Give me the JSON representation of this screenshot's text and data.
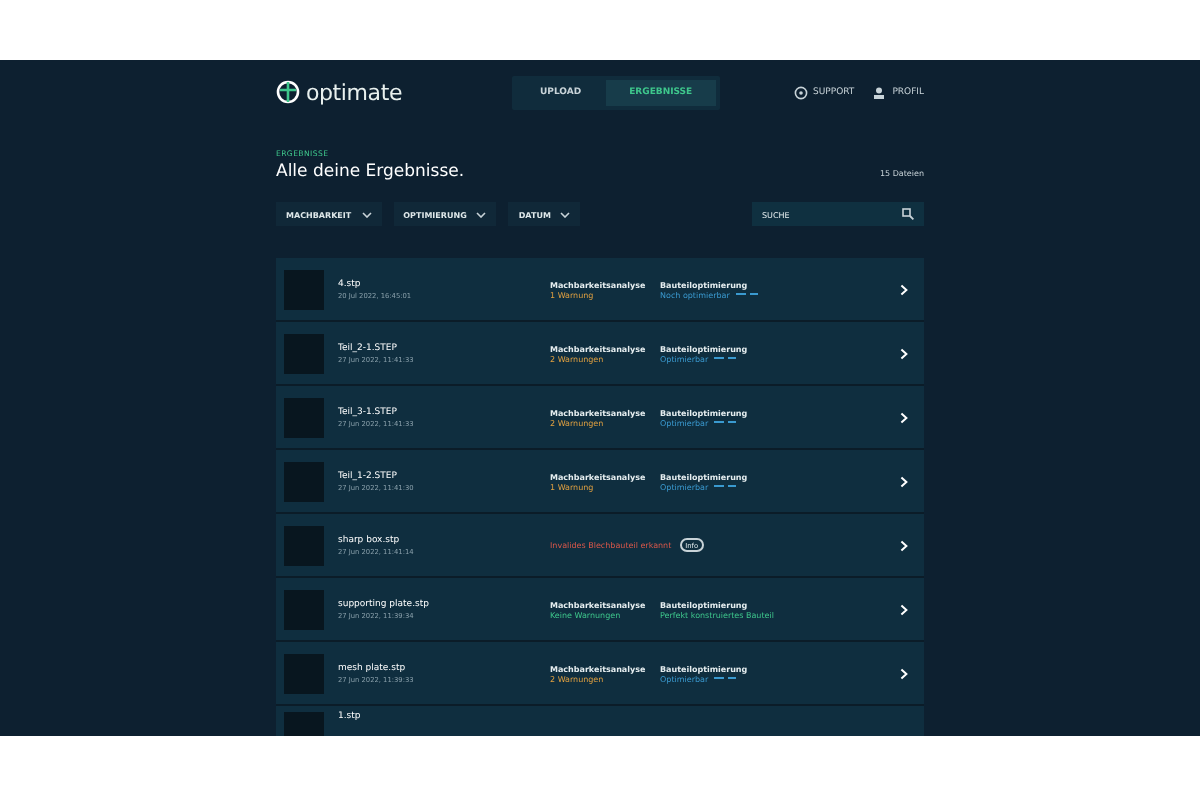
{
  "header": {
    "logo": "optimate",
    "nav": [
      {
        "label": "UPLOAD",
        "selected": false
      },
      {
        "label": "ERGEBNISSE",
        "selected": true
      }
    ],
    "links": [
      "SUPPORT",
      "PROFIL"
    ]
  },
  "breadcrumb": "ERGEBNISSE",
  "title": "Alle deine Ergebnisse.",
  "count": "15 Dateien",
  "filters": [
    "MACHBARKEIT",
    "OPTIMIERUNG",
    "DATUM"
  ],
  "search": {
    "placeholder": "SUCHE"
  },
  "rows": [
    {
      "name": "4.stp",
      "date": "20 Jul 2022, 16:45:01",
      "kind": "normal",
      "analysis": {
        "label": "Machbarkeitsanalyse",
        "value": "1 Warnung",
        "kind": "warning"
      },
      "optimization": {
        "label": "Bauteiloptimierung",
        "value": "Noch optimierbar",
        "kind": "optimizable"
      }
    },
    {
      "name": "Teil_2-1.STEP",
      "date": "27 Jun 2022, 11:41:33",
      "kind": "normal",
      "analysis": {
        "label": "Machbarkeitsanalyse",
        "value": "2 Warnungen",
        "kind": "warning"
      },
      "optimization": {
        "label": "Bauteiloptimierung",
        "value": "Optimierbar",
        "kind": "optimizable"
      }
    },
    {
      "name": "Teil_3-1.STEP",
      "date": "27 Jun 2022, 11:41:33",
      "kind": "normal",
      "analysis": {
        "label": "Machbarkeitsanalyse",
        "value": "2 Warnungen",
        "kind": "warning"
      },
      "optimization": {
        "label": "Bauteiloptimierung",
        "value": "Optimierbar",
        "kind": "optimizable"
      }
    },
    {
      "name": "Teil_1-2.STEP",
      "date": "27 Jun 2022, 11:41:30",
      "kind": "normal",
      "analysis": {
        "label": "Machbarkeitsanalyse",
        "value": "1 Warnung",
        "kind": "warning"
      },
      "optimization": {
        "label": "Bauteiloptimierung",
        "value": "Optimierbar",
        "kind": "optimizable"
      }
    },
    {
      "name": "sharp box.stp",
      "date": "27 Jun 2022, 11:41:14",
      "kind": "error",
      "message": "Invalides Blechbauteil erkannt",
      "badge": "Info"
    },
    {
      "name": "supporting plate.stp",
      "date": "27 Jun 2022, 11:39:34",
      "kind": "normal",
      "analysis": {
        "label": "Machbarkeitsanalyse",
        "value": "Keine Warnungen",
        "kind": "ok"
      },
      "optimization": {
        "label": "Bauteiloptimierung",
        "value": "Perfekt konstruiertes Bauteil",
        "kind": "perfect"
      }
    },
    {
      "name": "mesh plate.stp",
      "date": "27 Jun 2022, 11:39:33",
      "kind": "normal",
      "analysis": {
        "label": "Machbarkeitsanalyse",
        "value": "2 Warnungen",
        "kind": "warning"
      },
      "optimization": {
        "label": "Bauteiloptimierung",
        "value": "Optimierbar",
        "kind": "optimizable"
      }
    },
    {
      "name": "1.stp",
      "kind": "partial"
    }
  ]
}
